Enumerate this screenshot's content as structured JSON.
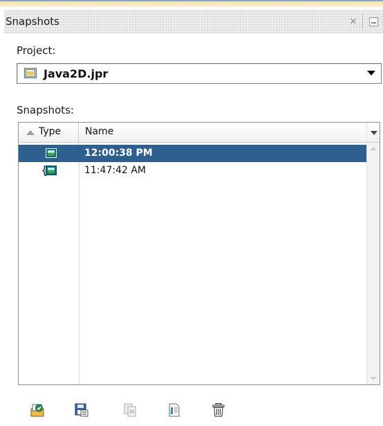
{
  "panel": {
    "title": "Snapshots",
    "close_glyph": "×"
  },
  "project": {
    "label": "Project:",
    "selected": "Java2D.jpr",
    "icon": "project-folder-icon"
  },
  "snapshots": {
    "label": "Snapshots:",
    "columns": [
      {
        "label": "Type",
        "sort": "ascending"
      },
      {
        "label": "Name"
      }
    ],
    "rows": [
      {
        "name": "12:00:38 PM",
        "type_icon": "snapshot-image-icon",
        "selected": true
      },
      {
        "name": "11:47:42 AM",
        "type_icon": "snapshot-image-icon",
        "selected": false
      }
    ]
  },
  "toolbar": {
    "buttons": [
      {
        "icon": "open-snapshot-icon",
        "enabled": true
      },
      {
        "icon": "save-snapshot-icon",
        "enabled": true
      },
      {
        "icon": "compare-snapshots-icon",
        "enabled": false
      },
      {
        "icon": "snapshot-info-icon",
        "enabled": true
      },
      {
        "icon": "delete-icon",
        "enabled": true
      }
    ]
  },
  "colors": {
    "selection": "#2f5f8e",
    "accent_top": "#8aa6cf",
    "accent_band": "#f2e4b8"
  }
}
